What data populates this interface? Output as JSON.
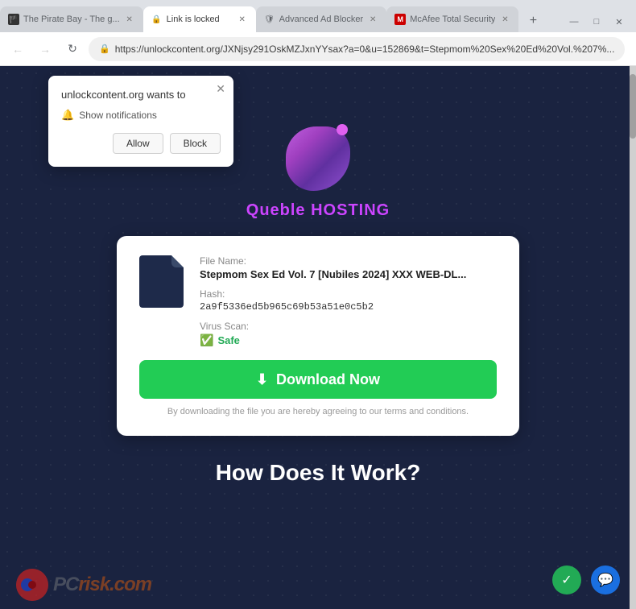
{
  "browser": {
    "tabs": [
      {
        "id": "tab1",
        "title": "The Pirate Bay - The g...",
        "favicon": "🏴",
        "active": false
      },
      {
        "id": "tab2",
        "title": "Link is locked",
        "favicon": "🔒",
        "active": true
      },
      {
        "id": "tab3",
        "title": "Advanced Ad Blocker",
        "favicon": "🛡",
        "active": false
      },
      {
        "id": "tab4",
        "title": "McAfee Total Security",
        "favicon": "M",
        "active": false
      }
    ],
    "url": "https://unlockcontent.org/JXNjsy291OskMZJxnYYsax?a=0&u=152869&t=Stepmom%20Sex%20Ed%20Vol.%207%...",
    "back_disabled": true
  },
  "notification": {
    "title": "unlockcontent.org wants to",
    "show_notifications": "Show notifications",
    "allow_label": "Allow",
    "block_label": "Block"
  },
  "logo": {
    "text": "Queble HOSTING"
  },
  "file_card": {
    "file_label": "File Name:",
    "file_name": "Stepmom Sex Ed Vol. 7 [Nubiles 2024] XXX WEB-DL...",
    "hash_label": "Hash:",
    "hash_value": "2a9f5336ed5b965c69b53a51e0c5b2",
    "virus_label": "Virus Scan:",
    "virus_status": "Safe",
    "download_button": "Download Now",
    "terms": "By downloading the file you are hereby agreeing to our terms and conditions."
  },
  "how_section": {
    "title": "How Does It Work?"
  },
  "pcrisk": {
    "text_before": "PC",
    "text_after": "risk.com"
  },
  "icons": {
    "lock": "🔒",
    "star": "☆",
    "download": "⬇",
    "profile": "👤",
    "menu": "⋮",
    "minimize": "—",
    "maximize": "□",
    "close": "✕",
    "back": "←",
    "forward": "→",
    "refresh": "↻",
    "check": "✓",
    "bell": "🔔",
    "chat": "💬",
    "download_arrow": "⬇"
  }
}
